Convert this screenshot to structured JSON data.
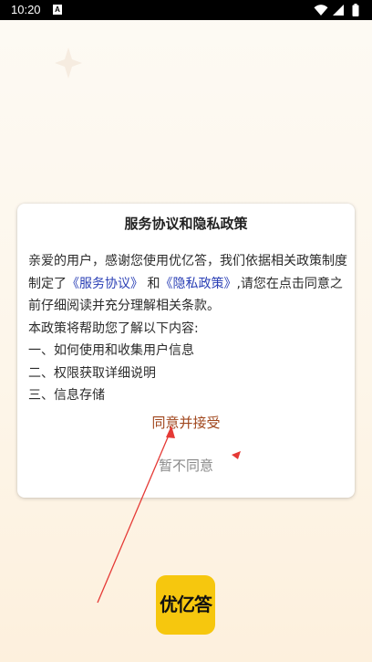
{
  "status_bar": {
    "time": "10:20",
    "notification_icon": "A",
    "icons": [
      "wifi-icon",
      "signal-icon",
      "battery-icon"
    ]
  },
  "dialog": {
    "title": "服务协议和隐私政策",
    "intro_before": "亲爱的用户，感谢您使用优亿答，我们依据相关政策制度制定了",
    "service_agreement_link": "《服务协议》",
    "and_text": " 和",
    "privacy_policy_link": "《隐私政策》",
    "intro_after": ",请您在点击同意之前仔细阅读并充分理解相关条款。",
    "policy_help": "本政策将帮助您了解以下内容:",
    "items": [
      "一、如何使用和收集用户信息",
      "二、权限获取详细说明",
      "三、信息存储"
    ],
    "agree_label": "同意并接受",
    "disagree_label": "暂不同意"
  },
  "app_logo": {
    "text": "优亿答",
    "color": "#f6c70e"
  },
  "colors": {
    "link": "#2a3fb5",
    "agree": "#a0461c",
    "disagree": "#8a8a8a",
    "annotation": "#e53935"
  }
}
